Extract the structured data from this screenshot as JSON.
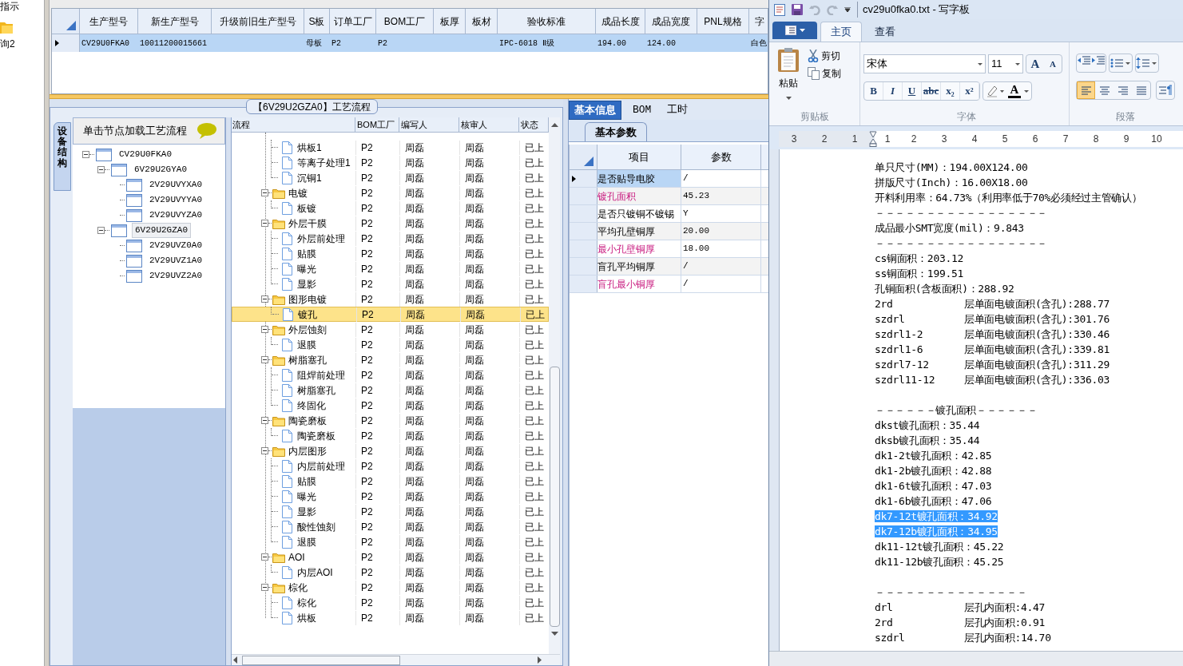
{
  "left_strip": {
    "labels": [
      "指示",
      "询2"
    ]
  },
  "product_table": {
    "columns": [
      "生产型号",
      "新生产型号",
      "升级前旧生产型号",
      "S板",
      "订单工厂",
      "BOM工厂",
      "板厚",
      "板材",
      "验收标准",
      "成品长度",
      "成品宽度",
      "PNL规格",
      "字"
    ],
    "rows": [
      {
        "selected": true,
        "cells": [
          "CV29U0FKA0",
          "10011200015661",
          null,
          "母板",
          "P2",
          "P2",
          null,
          null,
          "IPC-6018 Ⅱ级",
          "194.00",
          "124.00",
          null,
          "白色"
        ]
      }
    ]
  },
  "process_panel": {
    "title": "【6V29U2GZA0】工艺流程",
    "side_tab": "设备结构",
    "tree_header": "单击节点加载工艺流程",
    "device_tree": [
      {
        "label": "CV29U0FKA0",
        "expanded": true,
        "selected": false,
        "children": [
          {
            "label": "6V29U2GYA0",
            "expanded": true,
            "selected": false,
            "children": [
              {
                "label": "2V29UVYXA0",
                "selected": false
              },
              {
                "label": "2V29UVYYA0",
                "selected": false
              },
              {
                "label": "2V29UVYZA0",
                "selected": false
              }
            ]
          },
          {
            "label": "6V29U2GZA0",
            "expanded": true,
            "selected": true,
            "children": [
              {
                "label": "2V29UVZ0A0",
                "selected": false
              },
              {
                "label": "2V29UVZ1A0",
                "selected": false
              },
              {
                "label": "2V29UVZ2A0",
                "selected": false
              }
            ]
          }
        ]
      }
    ],
    "grid": {
      "columns": [
        "流程",
        "BOM工厂",
        "编写人",
        "核审人",
        "状态"
      ],
      "groups": [
        {
          "children": [
            {
              "label": "烘板1",
              "bom": "P2",
              "writer": "周磊",
              "reviewer": "周磊",
              "status": "已上",
              "selected": false
            },
            {
              "label": "等离子处理1",
              "bom": "P2",
              "writer": "周磊",
              "reviewer": "周磊",
              "status": "已上",
              "selected": false
            },
            {
              "label": "沉铜1",
              "bom": "P2",
              "writer": "周磊",
              "reviewer": "周磊",
              "status": "已上",
              "selected": false
            }
          ]
        },
        {
          "label": "电镀",
          "bom": "P2",
          "writer": "周磊",
          "reviewer": "周磊",
          "status": "已上",
          "expanded": true,
          "selected": false,
          "children": [
            {
              "label": "板镀",
              "bom": "P2",
              "writer": "周磊",
              "reviewer": "周磊",
              "status": "已上",
              "selected": false
            }
          ]
        },
        {
          "label": "外层干膜",
          "bom": "P2",
          "writer": "周磊",
          "reviewer": "周磊",
          "status": "已上",
          "expanded": true,
          "selected": false,
          "children": [
            {
              "label": "外层前处理",
              "bom": "P2",
              "writer": "周磊",
              "reviewer": "周磊",
              "status": "已上",
              "selected": false
            },
            {
              "label": "贴膜",
              "bom": "P2",
              "writer": "周磊",
              "reviewer": "周磊",
              "status": "已上",
              "selected": false
            },
            {
              "label": "曝光",
              "bom": "P2",
              "writer": "周磊",
              "reviewer": "周磊",
              "status": "已上",
              "selected": false
            },
            {
              "label": "显影",
              "bom": "P2",
              "writer": "周磊",
              "reviewer": "周磊",
              "status": "已上",
              "selected": false
            }
          ]
        },
        {
          "label": "图形电镀",
          "bom": "P2",
          "writer": "周磊",
          "reviewer": "周磊",
          "status": "已上",
          "expanded": true,
          "selected": false,
          "children": [
            {
              "label": "镀孔",
              "bom": "P2",
              "writer": "周磊",
              "reviewer": "周磊",
              "status": "已上",
              "selected": true
            }
          ]
        },
        {
          "label": "外层蚀刻",
          "bom": "P2",
          "writer": "周磊",
          "reviewer": "周磊",
          "status": "已上",
          "expanded": true,
          "selected": false,
          "children": [
            {
              "label": "退膜",
              "bom": "P2",
              "writer": "周磊",
              "reviewer": "周磊",
              "status": "已上",
              "selected": false
            }
          ]
        },
        {
          "label": "树脂塞孔",
          "bom": "P2",
          "writer": "周磊",
          "reviewer": "周磊",
          "status": "已上",
          "expanded": true,
          "selected": false,
          "children": [
            {
              "label": "阻焊前处理",
              "bom": "P2",
              "writer": "周磊",
              "reviewer": "周磊",
              "status": "已上",
              "selected": false
            },
            {
              "label": "树脂塞孔",
              "bom": "P2",
              "writer": "周磊",
              "reviewer": "周磊",
              "status": "已上",
              "selected": false
            },
            {
              "label": "终固化",
              "bom": "P2",
              "writer": "周磊",
              "reviewer": "周磊",
              "status": "已上",
              "selected": false
            }
          ]
        },
        {
          "label": "陶瓷磨板",
          "bom": "P2",
          "writer": "周磊",
          "reviewer": "周磊",
          "status": "已上",
          "expanded": true,
          "selected": false,
          "children": [
            {
              "label": "陶瓷磨板",
              "bom": "P2",
              "writer": "周磊",
              "reviewer": "周磊",
              "status": "已上",
              "selected": false
            }
          ]
        },
        {
          "label": "内层图形",
          "bom": "P2",
          "writer": "周磊",
          "reviewer": "周磊",
          "status": "已上",
          "expanded": true,
          "selected": false,
          "children": [
            {
              "label": "内层前处理",
              "bom": "P2",
              "writer": "周磊",
              "reviewer": "周磊",
              "status": "已上",
              "selected": false
            },
            {
              "label": "贴膜",
              "bom": "P2",
              "writer": "周磊",
              "reviewer": "周磊",
              "status": "已上",
              "selected": false
            },
            {
              "label": "曝光",
              "bom": "P2",
              "writer": "周磊",
              "reviewer": "周磊",
              "status": "已上",
              "selected": false
            },
            {
              "label": "显影",
              "bom": "P2",
              "writer": "周磊",
              "reviewer": "周磊",
              "status": "已上",
              "selected": false
            },
            {
              "label": "酸性蚀刻",
              "bom": "P2",
              "writer": "周磊",
              "reviewer": "周磊",
              "status": "已上",
              "selected": false
            },
            {
              "label": "退膜",
              "bom": "P2",
              "writer": "周磊",
              "reviewer": "周磊",
              "status": "已上",
              "selected": false
            }
          ]
        },
        {
          "label": "AOI",
          "bom": "P2",
          "writer": "周磊",
          "reviewer": "周磊",
          "status": "已上",
          "expanded": true,
          "selected": false,
          "children": [
            {
              "label": "内层AOI",
              "bom": "P2",
              "writer": "周磊",
              "reviewer": "周磊",
              "status": "已上",
              "selected": false
            }
          ]
        },
        {
          "label": "棕化",
          "bom": "P2",
          "writer": "周磊",
          "reviewer": "周磊",
          "status": "已上",
          "expanded": true,
          "selected": false,
          "children": [
            {
              "label": "棕化",
              "bom": "P2",
              "writer": "周磊",
              "reviewer": "周磊",
              "status": "已上",
              "selected": false
            },
            {
              "label": "烘板",
              "bom": "P2",
              "writer": "周磊",
              "reviewer": "周磊",
              "status": "已上",
              "selected": false
            }
          ]
        }
      ]
    }
  },
  "info_panel": {
    "tabs": [
      {
        "label": "基本信息",
        "selected": true
      },
      {
        "label": "BOM",
        "selected": false
      },
      {
        "label": "工时",
        "selected": false
      }
    ],
    "subtab": "基本参数",
    "columns": [
      "项目",
      "参数"
    ],
    "rows": [
      {
        "item": "是否贴导电胶",
        "value": "/",
        "highlighted": false,
        "selected": true
      },
      {
        "item": "镀孔面积",
        "value": "45.23",
        "highlighted": true,
        "selected": false
      },
      {
        "item": "是否只镀铜不镀锡",
        "value": "Y",
        "highlighted": false,
        "selected": false
      },
      {
        "item": "平均孔壁铜厚",
        "value": "20.00",
        "highlighted": false,
        "selected": false
      },
      {
        "item": "最小孔壁铜厚",
        "value": "18.00",
        "highlighted": true,
        "selected": false
      },
      {
        "item": "盲孔平均铜厚",
        "value": "/",
        "highlighted": false,
        "selected": false
      },
      {
        "item": "盲孔最小铜厚",
        "value": "/",
        "highlighted": true,
        "selected": false
      }
    ]
  },
  "wordpad": {
    "title": "cv29u0fka0.txt - 写字板",
    "tabs": [
      {
        "label": "主页",
        "selected": true
      },
      {
        "label": "查看",
        "selected": false
      }
    ],
    "paste": "粘贴",
    "cut": "剪切",
    "copy": "复制",
    "font_name": "宋体",
    "font_size": "11",
    "grow_shrink": [
      "A",
      "A"
    ],
    "format_buttons": [
      "B",
      "I",
      "U",
      "abc",
      "x₂",
      "x²"
    ],
    "font_color": "A",
    "alignment": [
      {
        "kind": "left",
        "selected": true
      },
      {
        "kind": "center",
        "selected": false
      },
      {
        "kind": "right",
        "selected": false
      },
      {
        "kind": "justify",
        "selected": false
      }
    ],
    "group_labels": [
      "剪贴板",
      "字体",
      "段落"
    ],
    "ruler": [
      "3",
      "2",
      "1",
      "1",
      "2",
      "3",
      "4",
      "5",
      "6",
      "7",
      "8",
      "9",
      "10"
    ],
    "lines": [
      {
        "kind": "text",
        "text": "单只尺寸(MM)：194.00X124.00",
        "selected": false
      },
      {
        "kind": "text",
        "text": "拼版尺寸(Inch)：16.00X18.00",
        "selected": false
      },
      {
        "kind": "text",
        "text": "开料利用率：64.73%（利用率低于70%必须经过主管确认）",
        "selected": false
      },
      {
        "kind": "text",
        "text": "－－－－－－－－－－－－－－－－－",
        "selected": false
      },
      {
        "kind": "text",
        "text": "成品最小SMT宽度(mil)：9.843",
        "selected": false
      },
      {
        "kind": "text",
        "text": "－－－－－－－－－－－－－－－－－",
        "selected": false
      },
      {
        "kind": "text",
        "text": "cs铜面积：203.12",
        "selected": false
      },
      {
        "kind": "text",
        "text": "ss铜面积：199.51",
        "selected": false
      },
      {
        "kind": "text",
        "text": "孔铜面积(含板面积)：288.92",
        "selected": false
      },
      {
        "kind": "columns",
        "left": "2rd",
        "right": "层单面电镀面积(含孔):288.77",
        "selected": false
      },
      {
        "kind": "columns",
        "left": "szdrl",
        "right": "层单面电镀面积(含孔):301.76",
        "selected": false
      },
      {
        "kind": "columns",
        "left": "szdrl1-2",
        "right": "层单面电镀面积(含孔):330.46",
        "selected": false
      },
      {
        "kind": "columns",
        "left": "szdrl1-6",
        "right": "层单面电镀面积(含孔):339.81",
        "selected": false
      },
      {
        "kind": "columns",
        "left": "szdrl7-12",
        "right": "层单面电镀面积(含孔):311.29",
        "selected": false
      },
      {
        "kind": "columns",
        "left": "szdrl11-12",
        "right": "层单面电镀面积(含孔):336.03",
        "selected": false
      },
      {
        "kind": "blank"
      },
      {
        "kind": "text",
        "text": "－－－－－－镀孔面积－－－－－－",
        "selected": false
      },
      {
        "kind": "text",
        "text": "dkst镀孔面积：35.44",
        "selected": false
      },
      {
        "kind": "text",
        "text": "dksb镀孔面积：35.44",
        "selected": false
      },
      {
        "kind": "text",
        "text": "dk1-2t镀孔面积：42.85",
        "selected": false
      },
      {
        "kind": "text",
        "text": "dk1-2b镀孔面积：42.88",
        "selected": false
      },
      {
        "kind": "text",
        "text": "dk1-6t镀孔面积：47.03",
        "selected": false
      },
      {
        "kind": "text",
        "text": "dk1-6b镀孔面积：47.06",
        "selected": false
      },
      {
        "kind": "text",
        "text": "dk7-12t镀孔面积：34.92",
        "selected": true
      },
      {
        "kind": "text",
        "text": "dk7-12b镀孔面积：34.95",
        "selected": true
      },
      {
        "kind": "text",
        "text": "dk11-12t镀孔面积：45.22",
        "selected": false
      },
      {
        "kind": "text",
        "text": "dk11-12b镀孔面积：45.25",
        "selected": false
      },
      {
        "kind": "blank"
      },
      {
        "kind": "text",
        "text": "－－－－－－－－－－－－－－－",
        "selected": false
      },
      {
        "kind": "columns",
        "left": "drl",
        "right": "层孔内面积:4.47",
        "selected": false
      },
      {
        "kind": "columns",
        "left": "2rd",
        "right": "层孔内面积:0.91",
        "selected": false
      },
      {
        "kind": "columns",
        "left": "szdrl",
        "right": "层孔内面积:14.70",
        "selected": false
      }
    ]
  }
}
